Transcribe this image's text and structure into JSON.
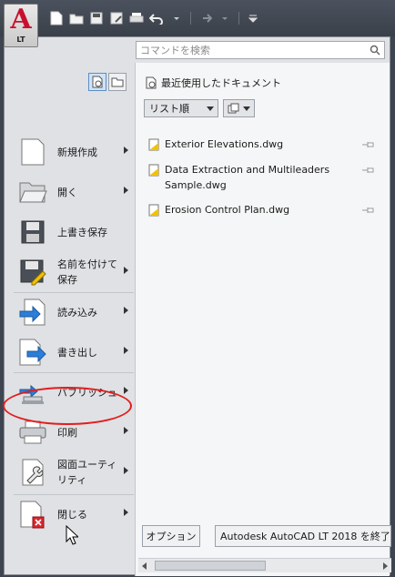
{
  "app": {
    "logo_letter": "A",
    "edition_badge": "LT",
    "brand_color": "#c8102e"
  },
  "quick_access": [
    "new-icon",
    "open-icon",
    "save-icon",
    "save-as-icon",
    "plot-icon",
    "undo-icon",
    "redo-icon",
    "customize-icon"
  ],
  "search": {
    "placeholder": "コマンドを検索",
    "value": ""
  },
  "menu_items": [
    {
      "label": "新規作成",
      "icon": "new-document-icon",
      "submenu": true
    },
    {
      "label": "開く",
      "icon": "folder-open-icon",
      "submenu": true
    },
    {
      "label": "上書き保存",
      "icon": "save-icon",
      "submenu": false
    },
    {
      "label": "名前を付けて保存",
      "icon": "save-as-icon",
      "submenu": true
    },
    {
      "label": "読み込み",
      "icon": "import-icon",
      "submenu": true
    },
    {
      "label": "書き出し",
      "icon": "export-icon",
      "submenu": true
    },
    {
      "label": "パブリッシュ",
      "icon": "publish-icon",
      "submenu": true
    },
    {
      "label": "印刷",
      "icon": "printer-icon",
      "submenu": true
    },
    {
      "label": "図面ユーティリティ",
      "icon": "wrench-icon",
      "submenu": true
    },
    {
      "label": "閉じる",
      "icon": "close-document-icon",
      "submenu": true
    }
  ],
  "recent": {
    "heading": "最近使用したドキュメント",
    "sort_value": "リスト順",
    "documents": [
      {
        "name": "Exterior Elevations.dwg"
      },
      {
        "name": "Data Extraction and Multileaders Sample.dwg"
      },
      {
        "name": "Erosion Control Plan.dwg"
      }
    ]
  },
  "footer": {
    "options_label": "オプション",
    "exit_label": "Autodesk AutoCAD LT 2018 を終了"
  },
  "annotation": {
    "highlighted_item": "印刷",
    "highlight_color": "#e21d1d"
  }
}
